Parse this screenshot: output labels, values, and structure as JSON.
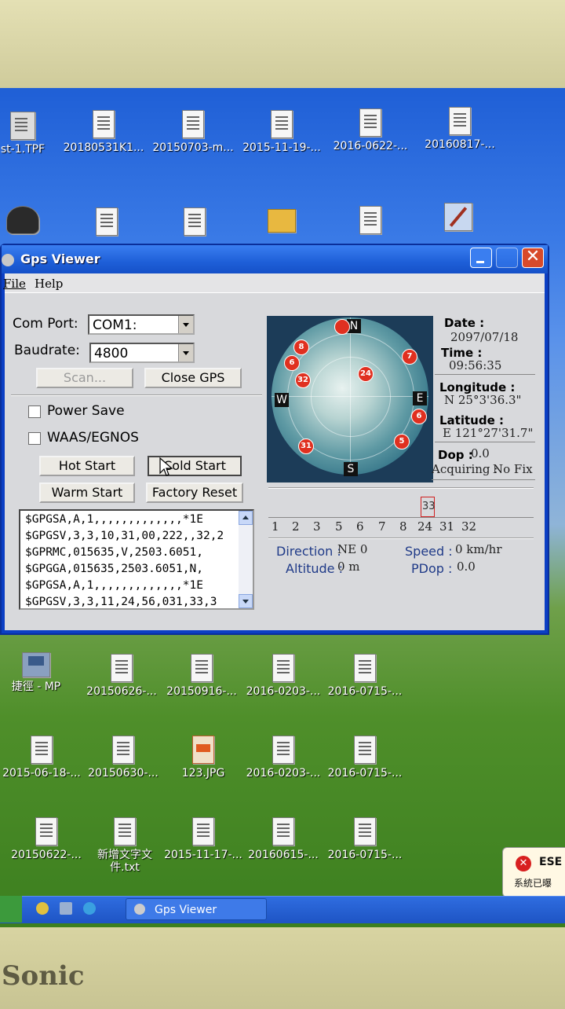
{
  "desktop": {
    "row1": [
      {
        "label": "st-1.TPF",
        "icon": "tpf-file-icon"
      },
      {
        "label": "20180531K1...",
        "icon": "text-file-icon"
      },
      {
        "label": "20150703-m...",
        "icon": "text-file-icon"
      },
      {
        "label": "2015-11-19-...",
        "icon": "text-file-icon"
      },
      {
        "label": "2016-0622-...",
        "icon": "text-file-icon"
      },
      {
        "label": "20160817-...",
        "icon": "text-file-icon"
      }
    ],
    "row3": [
      {
        "label": "捷徑 - MP",
        "icon": "computer-shortcut-icon"
      },
      {
        "label": "20150626-...",
        "icon": "text-file-icon"
      },
      {
        "label": "20150916-...",
        "icon": "text-file-icon"
      },
      {
        "label": "2016-0203-...",
        "icon": "text-file-icon"
      },
      {
        "label": "2016-0715-...",
        "icon": "text-file-icon"
      }
    ],
    "row4": [
      {
        "label": "2015-06-18-...",
        "icon": "text-file-icon"
      },
      {
        "label": "20150630-...",
        "icon": "text-file-icon"
      },
      {
        "label": "123.JPG",
        "icon": "image-file-icon"
      },
      {
        "label": "2016-0203-...",
        "icon": "text-file-icon"
      },
      {
        "label": "2016-0715-...",
        "icon": "text-file-icon"
      }
    ],
    "row5": [
      {
        "label": "20150622-...",
        "icon": "text-file-icon"
      },
      {
        "label": "新增文字文件.txt",
        "icon": "text-file-icon"
      },
      {
        "label": "2015-11-17-...",
        "icon": "text-file-icon"
      },
      {
        "label": "20160615-...",
        "icon": "text-file-icon"
      },
      {
        "label": "2016-0715-...",
        "icon": "text-file-icon"
      }
    ]
  },
  "window": {
    "title": "Gps Viewer",
    "menu": [
      "File",
      "Help"
    ]
  },
  "controls": {
    "com_port_label": "Com Port:",
    "com_port_value": "COM1:",
    "baudrate_label": "Baudrate:",
    "baudrate_value": "4800",
    "scan_button": "Scan...",
    "close_gps_button": "Close GPS",
    "power_save_label": "Power Save",
    "waas_label": "WAAS/EGNOS",
    "hot_start_button": "Hot Start",
    "cold_start_button": "Cold Start",
    "warm_start_button": "Warm Start",
    "factory_reset_button": "Factory Reset"
  },
  "nmea_log": [
    "$GPGSA,A,1,,,,,,,,,,,,,*1E",
    "$GPGSV,3,3,10,31,00,222,,32,2",
    "$GPRMC,015635,V,2503.6051,",
    "$GPGGA,015635,2503.6051,N,",
    "$GPGSA,A,1,,,,,,,,,,,,,*1E",
    "$GPGSV,3,3,11,24,56,031,33,3"
  ],
  "skyview": {
    "cardinals": {
      "n": "N",
      "e": "E",
      "s": "S",
      "w": "W"
    },
    "satellites": [
      "8",
      "6",
      "32",
      "24",
      "7",
      "6",
      "5",
      "31"
    ]
  },
  "info": {
    "date_label": "Date :",
    "date_value": "2097/07/18",
    "time_label": "Time :",
    "time_value": "09:56:35",
    "longitude_label": "Longitude :",
    "longitude_value": "N 25°3'36.3\"",
    "latitude_label": "Latitude :",
    "latitude_value": "E 121°27'31.7\"",
    "dop_label": "Dop :",
    "dop_value": "0.0",
    "acquiring_label": "Acquiring :",
    "acquiring_value": "No Fix"
  },
  "signal": {
    "highlight_label": "33",
    "prns": [
      "1",
      "2",
      "3",
      "5",
      "6",
      "7",
      "8",
      "24",
      "31",
      "32"
    ]
  },
  "status": {
    "direction_label": "Direction :",
    "direction_value": "NE 0",
    "speed_label": "Speed :",
    "speed_value": "0 km/hr",
    "altitude_label": "Altitude :",
    "altitude_value": "0 m",
    "pdop_label": "PDop :",
    "pdop_value": "0.0"
  },
  "taskbar": {
    "task_label": "Gps Viewer"
  },
  "toast": {
    "title": "ESE",
    "text": "系統已曝"
  },
  "monitor": {
    "brand": "Sonic"
  }
}
